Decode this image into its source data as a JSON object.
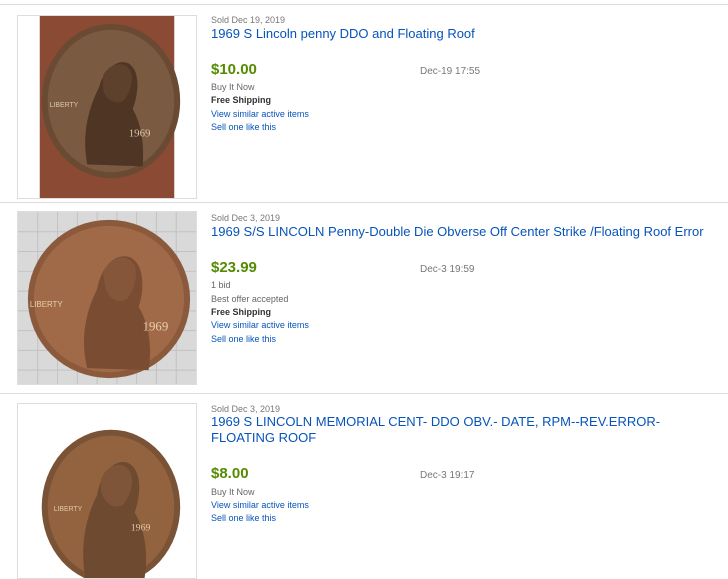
{
  "listings": [
    {
      "sold_date": "Sold Dec 19, 2019",
      "title": "1969 S Lincoln penny DDO and Floating Roof",
      "price": "$10.00",
      "time": "Dec-19 17:55",
      "purchase_type": "Buy It Now",
      "shipping": "Free Shipping",
      "view_similar": "View similar active items",
      "sell_one": "Sell one like this",
      "coin_lettering": "LIBERTY 1969"
    },
    {
      "sold_date": "Sold Dec 3, 2019",
      "title": "1969 S/S LINCOLN Penny-Double Die Obverse Off Center Strike /Floating Roof Error",
      "price": "$23.99",
      "time": "Dec-3 19:59",
      "bids": "1 bid",
      "purchase_type": "Best offer accepted",
      "shipping": "Free Shipping",
      "view_similar": "View similar active items",
      "sell_one": "Sell one like this",
      "coin_lettering": "LIBERTY 1969"
    },
    {
      "sold_date": "Sold Dec 3, 2019",
      "title": "1969 S LINCOLN MEMORIAL CENT- DDO OBV.- DATE, RPM--REV.ERROR- FLOATING ROOF",
      "price": "$8.00",
      "time": "Dec-3 19:17",
      "purchase_type": "Buy It Now",
      "view_similar": "View similar active items",
      "sell_one": "Sell one like this",
      "coin_lettering": "LIBERTY 1969"
    }
  ],
  "colors": {
    "link": "#0654ba",
    "price": "#548b00",
    "muted": "#777777"
  }
}
